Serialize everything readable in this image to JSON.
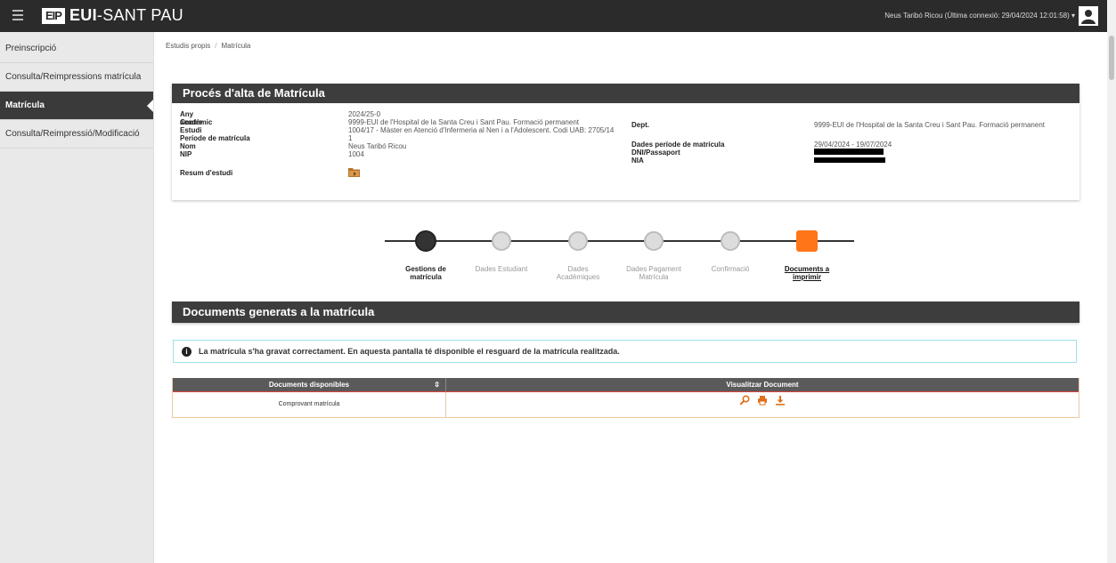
{
  "header": {
    "logo_mark": "EIP",
    "app_title_bold": "EUI",
    "app_title_rest": "-SANT PAU",
    "user_text": "Neus Taribó Ricou (Última connexió: 29/04/2024 12:01:58) ▾"
  },
  "sidebar": {
    "items": [
      {
        "label": "Preinscripció"
      },
      {
        "label": "Consulta/Reimpressions matrícula"
      },
      {
        "label": "Matrícula"
      },
      {
        "label": "Consulta/Reimpressió/Modificació"
      }
    ]
  },
  "breadcrumb": {
    "root": "Estudis propis",
    "sep": "/",
    "current": "Matrícula"
  },
  "proces": {
    "title": "Procés d'alta de Matrícula",
    "left": [
      {
        "label": "Any acadèmic",
        "value": "2024/25-0"
      },
      {
        "label": "Centre",
        "value": "9999-EUI de l'Hospital de la Santa Creu i Sant Pau. Formació permanent"
      },
      {
        "label": "Estudi",
        "value": "1004/17 - Màster en Atenció d'Infermeria al Nen i a l'Adolescent. Codi UAB: 2705/14"
      },
      {
        "label": "Període de matrícula",
        "value": "1"
      },
      {
        "label": "Nom",
        "value": "Neus Taribó Ricou"
      },
      {
        "label": "NIP",
        "value": "1004"
      }
    ],
    "right": [
      {
        "label": "Dept.",
        "value": "9999-EUI de l'Hospital de la Santa Creu i Sant Pau. Formació permanent"
      },
      {
        "label": "Dades període de matrícula",
        "value": "29/04/2024 - 19/07/2024"
      },
      {
        "label": "DNI/Passaport",
        "value": ""
      },
      {
        "label": "NIA",
        "value": ""
      }
    ],
    "resum_label": "Resum d'estudi"
  },
  "steps": [
    {
      "line1": "Gestions de",
      "line2": "matrícula",
      "state": "done"
    },
    {
      "line1": "Dades Estudiant",
      "line2": "",
      "state": "pending"
    },
    {
      "line1": "Dades",
      "line2": "Acadèmiques",
      "state": "pending"
    },
    {
      "line1": "Dades Pagament",
      "line2": "Matrícula",
      "state": "pending"
    },
    {
      "line1": "Confirmació",
      "line2": "",
      "state": "pending"
    },
    {
      "line1": "Documents a",
      "line2": "imprimir",
      "state": "current"
    }
  ],
  "documents": {
    "title": "Documents generats a la matrícula",
    "alert": "La matrícula s'ha gravat correctament. En aquesta pantalla té disponible el resguard de la matrícula realitzada.",
    "col1": "Documents disponibles",
    "col2": "Visualitzar Document",
    "rows": [
      {
        "name": "Comprovant matrícula"
      }
    ]
  },
  "colors": {
    "accent": "#ff7518",
    "header_bg": "#2b2b2b",
    "panel_header": "#3d3d3d",
    "active_sidebar": "#3a3a3a"
  }
}
